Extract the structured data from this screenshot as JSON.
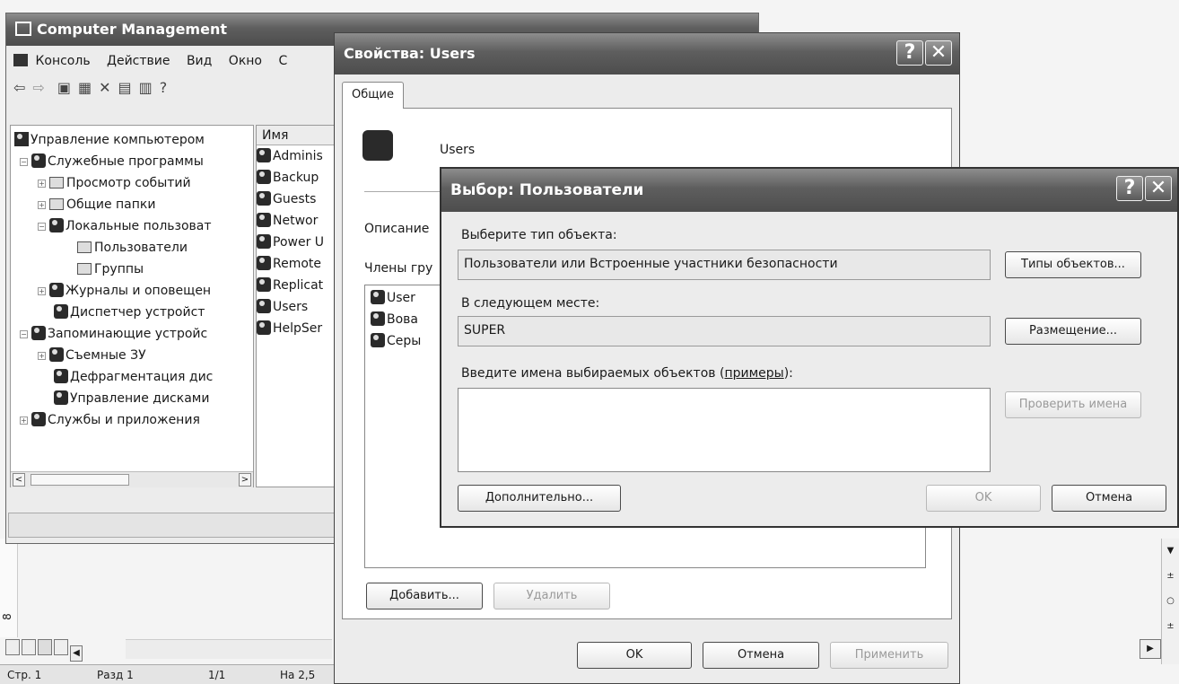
{
  "cm": {
    "title": "Computer Management",
    "menu": [
      "Консоль",
      "Действие",
      "Вид",
      "Окно",
      "С"
    ],
    "tree": [
      "Управление компьютером",
      "Служебные программы",
      "Просмотр событий",
      "Общие папки",
      "Локальные пользоват",
      "Пользователи",
      "Группы",
      "Журналы и оповещен",
      "Диспетчер устройст",
      "Запоминающие устройс",
      "Съемные ЗУ",
      "Дефрагментация дис",
      "Управление дисками",
      "Службы и приложения"
    ],
    "list_header": "Имя",
    "list": [
      "Adminis",
      "Backup",
      "Guests",
      "Networ",
      "Power U",
      "Remote",
      "Replicat",
      "Users",
      "HelpSer"
    ]
  },
  "word": {
    "status": [
      "Стр. 1",
      "Разд 1",
      "1/1",
      "На 2,5"
    ],
    "ruler": [
      "8"
    ]
  },
  "props": {
    "title": "Свойства: Users",
    "tab": "Общие",
    "name": "Users",
    "description_label": "Описание",
    "members_label": "Члены гру",
    "members": [
      "User",
      "Вова",
      "Серы"
    ],
    "add_label": "Добавить...",
    "remove_label": "Удалить",
    "ok_label": "OK",
    "cancel_label": "Отмена",
    "apply_label": "Применить"
  },
  "select": {
    "title": "Выбор: Пользователи",
    "object_type_label": "Выберите тип объекта:",
    "object_type_value": "Пользователи или Встроенные участники безопасности",
    "object_types_button": "Типы объектов...",
    "location_label": "В следующем месте:",
    "location_value": "SUPER",
    "location_button": "Размещение...",
    "names_label": "Введите имена выбираемых объектов (",
    "names_link": "примеры",
    "names_label_end": "):",
    "check_names_button": "Проверить имена",
    "advanced_button": "Дополнительно...",
    "ok_label": "OK",
    "cancel_label": "Отмена"
  },
  "title_buttons": {
    "help": "?",
    "close": "✕"
  }
}
